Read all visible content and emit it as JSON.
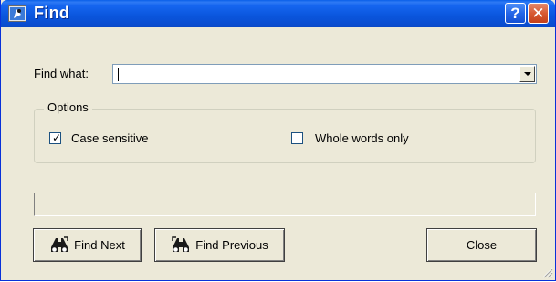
{
  "window": {
    "title": "Find",
    "help_label": "?",
    "close_label": "✕"
  },
  "find_what": {
    "label": "Find what:",
    "value": ""
  },
  "options": {
    "group_label": "Options",
    "case_sensitive": {
      "label": "Case sensitive",
      "checked": true
    },
    "whole_words": {
      "label": "Whole words only",
      "checked": false
    }
  },
  "progress": {
    "value": 0
  },
  "buttons": {
    "find_next": "Find Next",
    "find_previous": "Find Previous",
    "close": "Close"
  },
  "icons": {
    "app": "find-app-icon",
    "binoculars": "binoculars-icon"
  }
}
